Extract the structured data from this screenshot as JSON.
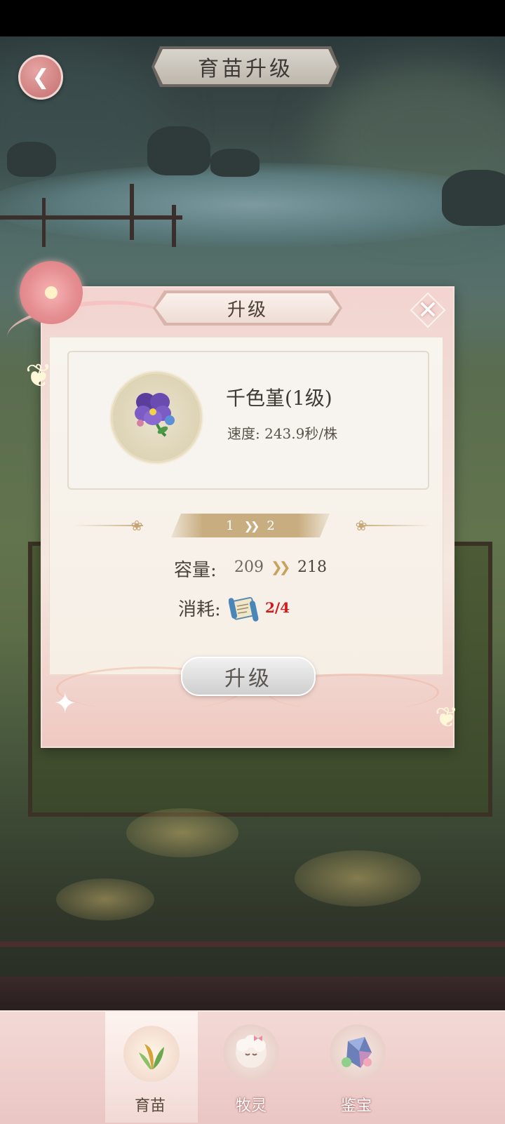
{
  "header": {
    "title": "育苗升级"
  },
  "dialog": {
    "title": "升级",
    "item": {
      "name": "千色堇(1级)",
      "speed": "速度: 243.9秒/株"
    },
    "level": {
      "from": "1",
      "to": "2"
    },
    "capacity": {
      "label": "容量:",
      "old": "209",
      "new": "218"
    },
    "cost": {
      "label": "消耗:",
      "value": "2/4"
    },
    "upgrade_button": "升级"
  },
  "bottom_nav": {
    "tabs": [
      {
        "label": "育苗",
        "active": true
      },
      {
        "label": "牧灵",
        "active": false
      },
      {
        "label": "鉴宝",
        "active": false
      }
    ]
  },
  "colors": {
    "accent_pink": "#e8a5a8",
    "cost_red": "#d11a1a",
    "gold": "#c8ad80"
  }
}
